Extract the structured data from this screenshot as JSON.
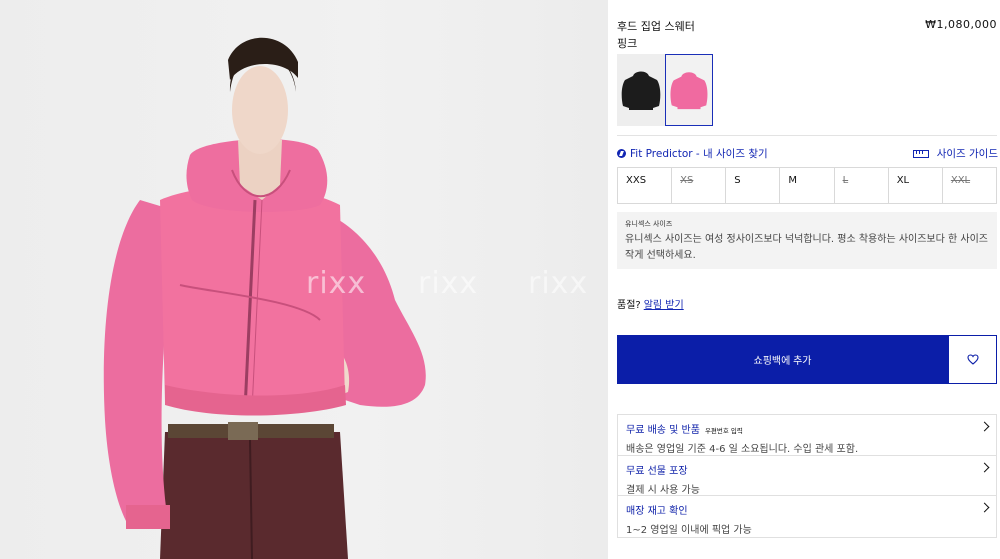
{
  "product": {
    "name": "후드 집업 스웨터",
    "price": "₩1,080,000",
    "color": "핑크",
    "watermarks": [
      "rixx",
      "rixx",
      "rixx"
    ],
    "swatches": [
      {
        "name": "black",
        "color": "#1c1c1c"
      },
      {
        "name": "pink",
        "color": "#f06aa0",
        "selected": true
      }
    ]
  },
  "fit_predictor": {
    "label": "Fit Predictor - 내 사이즈 찾기",
    "icon": "fit-icon"
  },
  "size_guide": {
    "label": "사이즈 가이드",
    "icon": "ruler-icon"
  },
  "sizes": [
    {
      "label": "XXS",
      "available": true
    },
    {
      "label": "XS",
      "available": false
    },
    {
      "label": "S",
      "available": true
    },
    {
      "label": "M",
      "available": true
    },
    {
      "label": "L",
      "available": false
    },
    {
      "label": "XL",
      "available": true
    },
    {
      "label": "XXL",
      "available": false
    }
  ],
  "unisex_note": {
    "heading": "유니섹스 사이즈",
    "body": "유니섹스 사이즈는 여성 정사이즈보다 넉넉합니다. 평소 착용하는 사이즈보다 한 사이즈 작게 선택하세요."
  },
  "restock": {
    "question": "품절?",
    "link": "알림 받기"
  },
  "cart": {
    "add_label": "쇼핑백에 추가",
    "wishlist_icon": "heart-icon"
  },
  "info_rows": [
    {
      "title": "무료 배송 및 반품",
      "tag": "우편번호 입력",
      "text": "배송은 영업일 기준 4-6 일 소요됩니다. 수입 관세 포함."
    },
    {
      "title": "무료 선물 포장",
      "tag": "",
      "text": "결제 시 사용 가능"
    },
    {
      "title": "매장 재고 확인",
      "tag": "",
      "text": "1~2 영업일 이내에 픽업 가능"
    }
  ],
  "colors": {
    "accent": "#0b1ea8",
    "link": "#1226b3",
    "hoodie": "#f06aa0"
  }
}
